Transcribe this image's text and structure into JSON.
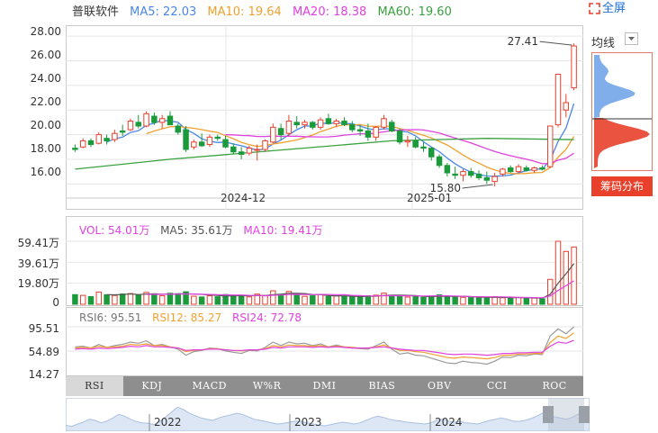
{
  "header": {
    "stock_name": "普联软件",
    "ma": [
      {
        "label": "MA5: 22.03",
        "color": "#4a86e8"
      },
      {
        "label": "MA10: 19.64",
        "color": "#f0a030"
      },
      {
        "label": "MA20: 18.38",
        "color": "#e040e0"
      },
      {
        "label": "MA60: 19.60",
        "color": "#3aa040"
      }
    ],
    "fullscreen_label": "全屏"
  },
  "side": {
    "avg_label": "均线",
    "chip_button": "筹码分布"
  },
  "volume_legend": [
    {
      "label": "VOL: 54.01万",
      "color": "#e040e0"
    },
    {
      "label": "MA5: 35.61万",
      "color": "#555555"
    },
    {
      "label": "MA10: 19.41万",
      "color": "#e040e0"
    }
  ],
  "rsi_legend": [
    {
      "label": "RSI6: 95.51",
      "color": "#777777"
    },
    {
      "label": "RSI12: 85.27",
      "color": "#f0a030"
    },
    {
      "label": "RSI24: 72.78",
      "color": "#e040e0"
    }
  ],
  "tabs": [
    "RSI",
    "KDJ",
    "MACD",
    "W%R",
    "DMI",
    "BIAS",
    "OBV",
    "CCI",
    "ROC"
  ],
  "navigator_years": [
    "2022",
    "2023",
    "2024"
  ],
  "colors": {
    "up": "#e8402b",
    "down": "#1a9a3a",
    "grid": "#e6e6e6"
  },
  "chart_data": {
    "type": "candlestick",
    "price_axis": {
      "ticks": [
        "28.00",
        "26.00",
        "24.00",
        "22.00",
        "20.00",
        "18.00",
        "16.00"
      ],
      "ylim": [
        15.0,
        28.3
      ]
    },
    "x_ticks": [
      "2024-12",
      "2025-01"
    ],
    "annotations": [
      {
        "label": "27.41",
        "value": 27.41
      },
      {
        "label": "15.80",
        "value": 15.8
      }
    ],
    "volume_axis": {
      "ticks": [
        "59.41万",
        "39.61万",
        "19.80万",
        "0"
      ],
      "ylim": [
        0,
        59.41
      ]
    },
    "rsi_axis": {
      "ticks": [
        "95.51",
        "54.89",
        "14.27"
      ],
      "ylim": [
        14.27,
        95.51
      ]
    },
    "candles": [
      [
        18.9,
        19.2,
        18.6,
        18.8
      ],
      [
        19.0,
        19.7,
        18.9,
        19.5
      ],
      [
        19.5,
        19.7,
        19.0,
        19.2
      ],
      [
        19.3,
        20.2,
        19.2,
        20.0
      ],
      [
        19.7,
        20.0,
        19.2,
        19.5
      ],
      [
        19.6,
        20.4,
        19.4,
        20.1
      ],
      [
        20.3,
        20.8,
        19.9,
        20.2
      ],
      [
        20.4,
        21.3,
        20.3,
        21.1
      ],
      [
        21.0,
        21.6,
        20.5,
        20.7
      ],
      [
        20.7,
        21.9,
        20.6,
        21.7
      ],
      [
        21.5,
        21.8,
        20.8,
        21.0
      ],
      [
        21.0,
        21.6,
        20.5,
        21.3
      ],
      [
        21.5,
        21.9,
        20.8,
        20.8
      ],
      [
        20.7,
        20.9,
        20.0,
        20.2
      ],
      [
        20.4,
        20.7,
        18.6,
        18.8
      ],
      [
        19.0,
        19.6,
        18.8,
        19.4
      ],
      [
        19.4,
        20.1,
        19.0,
        19.1
      ],
      [
        19.2,
        20.0,
        19.0,
        19.8
      ],
      [
        19.8,
        20.0,
        19.5,
        19.7
      ],
      [
        19.6,
        19.9,
        18.9,
        19.0
      ],
      [
        19.0,
        19.3,
        18.4,
        18.6
      ],
      [
        18.6,
        19.0,
        18.0,
        18.4
      ],
      [
        18.5,
        19.1,
        18.3,
        18.9
      ],
      [
        18.8,
        19.2,
        17.9,
        18.8
      ],
      [
        18.8,
        19.6,
        18.6,
        19.5
      ],
      [
        19.4,
        20.9,
        19.3,
        20.6
      ],
      [
        20.5,
        20.9,
        19.6,
        20.0
      ],
      [
        20.1,
        21.6,
        19.9,
        21.1
      ],
      [
        21.0,
        21.5,
        20.5,
        20.8
      ],
      [
        20.8,
        21.2,
        20.5,
        21.0
      ],
      [
        21.0,
        21.1,
        20.4,
        20.6
      ],
      [
        20.6,
        21.4,
        20.4,
        21.2
      ],
      [
        21.3,
        21.7,
        20.8,
        20.9
      ],
      [
        20.9,
        21.3,
        20.6,
        21.1
      ],
      [
        21.1,
        21.4,
        20.7,
        20.8
      ],
      [
        20.8,
        21.1,
        20.2,
        20.4
      ],
      [
        20.4,
        20.8,
        19.9,
        20.3
      ],
      [
        20.3,
        20.9,
        19.5,
        19.8
      ],
      [
        19.8,
        20.7,
        19.5,
        20.6
      ],
      [
        20.6,
        21.6,
        20.4,
        21.3
      ],
      [
        21.0,
        21.2,
        20.2,
        20.3
      ],
      [
        20.3,
        20.5,
        19.2,
        19.4
      ],
      [
        19.4,
        19.9,
        19.0,
        19.5
      ],
      [
        19.5,
        19.8,
        18.9,
        19.0
      ],
      [
        19.0,
        19.4,
        18.6,
        18.9
      ],
      [
        18.9,
        19.0,
        17.9,
        18.2
      ],
      [
        18.2,
        18.4,
        17.3,
        17.5
      ],
      [
        17.5,
        17.7,
        16.6,
        16.9
      ],
      [
        16.8,
        17.4,
        16.4,
        16.7
      ],
      [
        16.7,
        17.2,
        16.2,
        17.0
      ],
      [
        17.0,
        17.3,
        16.5,
        16.7
      ],
      [
        16.8,
        17.1,
        16.3,
        16.5
      ],
      [
        16.5,
        17.0,
        16.0,
        16.3
      ],
      [
        16.2,
        16.9,
        15.8,
        16.6
      ],
      [
        16.8,
        17.3,
        16.6,
        17.2
      ],
      [
        17.3,
        17.5,
        16.9,
        17.0
      ],
      [
        17.0,
        17.6,
        16.9,
        17.4
      ],
      [
        17.3,
        17.5,
        17.0,
        17.1
      ],
      [
        17.1,
        17.4,
        16.9,
        17.3
      ],
      [
        17.3,
        17.5,
        17.1,
        17.2
      ],
      [
        17.4,
        20.7,
        17.3,
        20.7
      ],
      [
        20.8,
        24.9,
        20.6,
        24.9
      ],
      [
        22.0,
        23.3,
        21.4,
        22.6
      ],
      [
        23.8,
        27.41,
        23.6,
        27.2
      ]
    ],
    "volume": [
      9.1,
      8.4,
      7.2,
      11.5,
      9.0,
      8.3,
      9.7,
      10.1,
      8.8,
      11.2,
      9.5,
      8.1,
      10.4,
      9.9,
      11.8,
      7.6,
      6.9,
      8.0,
      7.1,
      9.2,
      8.5,
      7.8,
      7.0,
      9.6,
      8.2,
      12.7,
      9.4,
      12.1,
      8.8,
      7.5,
      8.0,
      9.1,
      7.3,
      7.9,
      7.2,
      6.9,
      7.4,
      8.1,
      8.6,
      10.5,
      8.3,
      7.9,
      6.8,
      7.4,
      6.5,
      7.7,
      8.9,
      7.5,
      6.9,
      6.6,
      6.3,
      6.8,
      5.9,
      7.2,
      6.1,
      5.8,
      6.4,
      5.5,
      5.9,
      5.2,
      23.5,
      59.41,
      49.8,
      54.01
    ],
    "volume_ma5": [],
    "rsi6": [
      62,
      63,
      60,
      66,
      61,
      64,
      66,
      70,
      68,
      72,
      64,
      66,
      62,
      58,
      48,
      54,
      56,
      60,
      59,
      55,
      53,
      51,
      56,
      55,
      61,
      70,
      64,
      70,
      67,
      68,
      64,
      67,
      62,
      65,
      62,
      60,
      59,
      58,
      64,
      70,
      58,
      50,
      52,
      48,
      47,
      43,
      39,
      35,
      34,
      38,
      36,
      35,
      33,
      38,
      45,
      44,
      48,
      47,
      50,
      49,
      80,
      92,
      84,
      95.51
    ],
    "rsi12": [
      60,
      61,
      60,
      63,
      61,
      62,
      63,
      66,
      65,
      67,
      64,
      64,
      62,
      60,
      54,
      56,
      57,
      59,
      59,
      57,
      56,
      55,
      57,
      57,
      59,
      64,
      62,
      65,
      64,
      64,
      63,
      64,
      62,
      63,
      62,
      61,
      60,
      60,
      62,
      65,
      60,
      56,
      56,
      54,
      53,
      50,
      47,
      44,
      43,
      45,
      44,
      43,
      42,
      44,
      48,
      48,
      50,
      50,
      51,
      51,
      69,
      80,
      76,
      85.27
    ],
    "rsi24": [
      58,
      59,
      58,
      60,
      59,
      60,
      61,
      63,
      62,
      64,
      62,
      62,
      61,
      60,
      56,
      57,
      57,
      58,
      58,
      57,
      56,
      56,
      57,
      57,
      58,
      61,
      60,
      62,
      62,
      62,
      61,
      62,
      61,
      62,
      61,
      60,
      60,
      60,
      61,
      62,
      60,
      58,
      57,
      56,
      56,
      54,
      52,
      50,
      49,
      50,
      50,
      49,
      48,
      49,
      51,
      51,
      52,
      52,
      53,
      53,
      63,
      70,
      68,
      72.78
    ],
    "navigator": [
      40,
      38,
      42,
      45,
      50,
      48,
      44,
      47,
      52,
      58,
      55,
      50,
      46,
      44,
      43,
      41,
      46,
      54,
      62,
      70,
      66,
      60,
      56,
      52,
      50,
      48,
      52,
      55,
      57,
      60,
      58,
      54,
      50,
      48,
      46,
      44,
      42,
      43,
      45,
      47,
      46,
      44,
      42,
      40,
      39,
      41,
      43,
      45,
      44,
      42,
      44,
      48,
      52,
      55,
      53,
      50,
      48,
      47,
      45,
      44,
      43,
      42,
      44,
      48,
      50,
      47,
      45,
      46,
      44,
      43,
      42,
      45,
      48,
      50,
      52,
      50,
      47,
      46,
      48,
      51,
      55,
      60,
      58,
      54,
      52,
      50,
      53,
      58,
      62,
      66
    ]
  }
}
